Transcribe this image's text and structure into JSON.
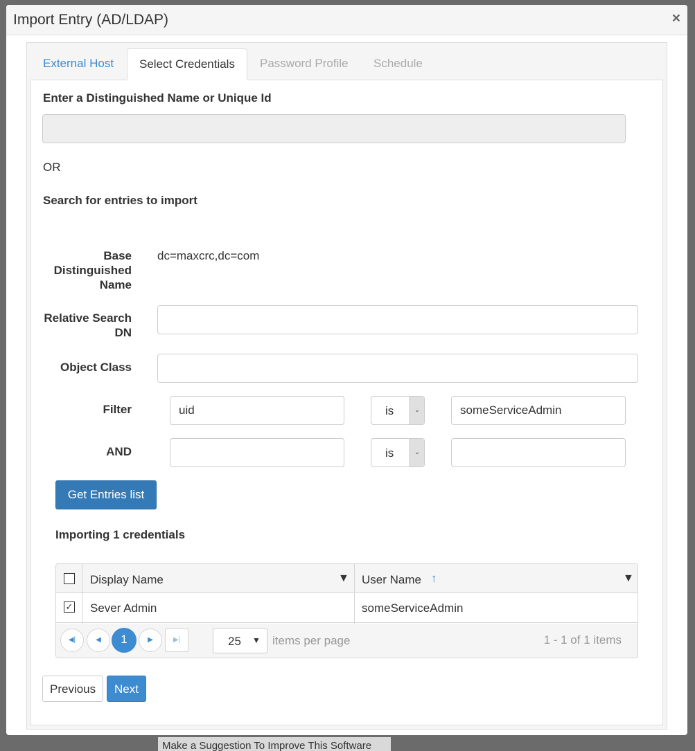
{
  "background": {
    "suggestion_link": "Make a Suggestion To Improve This Software"
  },
  "modal": {
    "title": "Import Entry (AD/LDAP)",
    "close": "×"
  },
  "tabs": [
    {
      "label": "External Host",
      "state": "link"
    },
    {
      "label": "Select Credentials",
      "state": "active"
    },
    {
      "label": "Password Profile",
      "state": "disabled"
    },
    {
      "label": "Schedule",
      "state": "disabled"
    }
  ],
  "form": {
    "dn_heading": "Enter a Distinguished Name or Unique Id",
    "dn_value": "",
    "or": "OR",
    "search_heading": "Search for entries to import",
    "base_dn_label": "Base Distinguished Name",
    "base_dn_value": "dc=maxcrc,dc=com",
    "relative_label": "Relative Search DN",
    "relative_value": "",
    "object_class_label": "Object Class",
    "object_class_value": "",
    "filter_label": "Filter",
    "filter_attr": "uid",
    "filter_op": "is",
    "filter_value": "someServiceAdmin",
    "and_label": "AND",
    "and_attr": "",
    "and_op": "is",
    "and_value": "",
    "get_entries": "Get Entries list",
    "importing": "Importing 1 credentials"
  },
  "grid": {
    "columns": [
      "Display Name",
      "User Name"
    ],
    "sort": {
      "column": "User Name",
      "direction": "ascending"
    },
    "rows": [
      {
        "checked": true,
        "display_name": "Sever Admin",
        "user_name": "someServiceAdmin"
      }
    ],
    "page": "1",
    "page_size": "25",
    "items_per_page": "items per page",
    "summary": "1 - 1 of 1 items"
  },
  "footer": {
    "previous": "Previous",
    "next": "Next"
  },
  "colors": {
    "primary": "#337ab7",
    "link": "#3d8bd0",
    "disabled": "#aaa"
  }
}
